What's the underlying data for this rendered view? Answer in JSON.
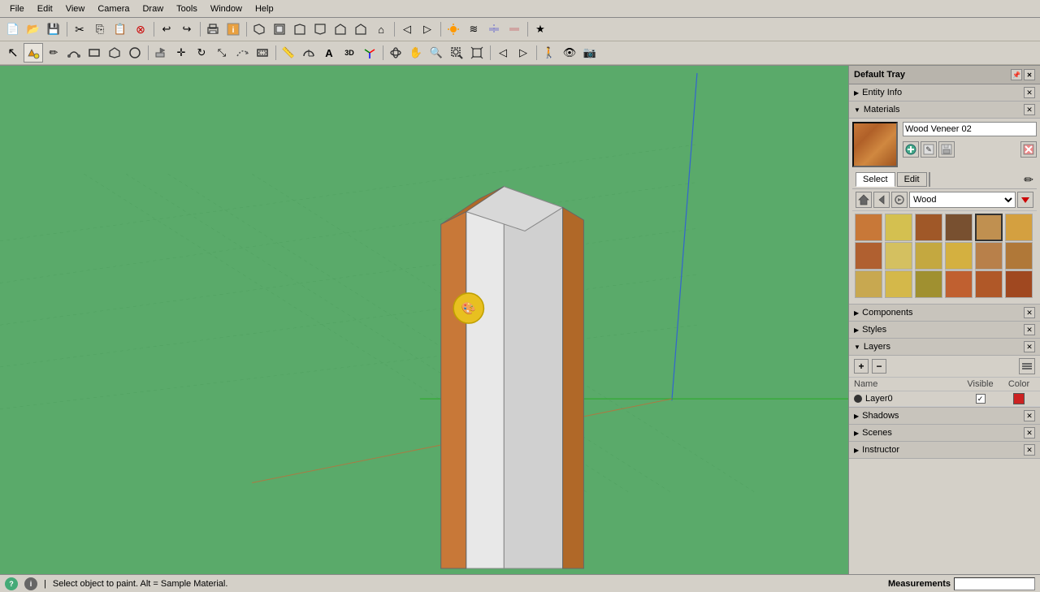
{
  "menubar": {
    "items": [
      "File",
      "Edit",
      "View",
      "Camera",
      "Draw",
      "Tools",
      "Window",
      "Help"
    ]
  },
  "toolbar1": {
    "buttons": [
      {
        "name": "new",
        "icon": "📄"
      },
      {
        "name": "open",
        "icon": "📂"
      },
      {
        "name": "save",
        "icon": "💾"
      },
      {
        "name": "cut",
        "icon": "✂"
      },
      {
        "name": "copy",
        "icon": "📋"
      },
      {
        "name": "paste",
        "icon": "📌"
      },
      {
        "name": "erase",
        "icon": "⊗"
      },
      {
        "name": "undo",
        "icon": "↩"
      },
      {
        "name": "redo",
        "icon": "↪"
      },
      {
        "name": "print",
        "icon": "🖨"
      },
      {
        "name": "model-info",
        "icon": "🔷"
      },
      {
        "name": "3d-warehouse",
        "icon": "🔺"
      },
      {
        "name": "iso",
        "icon": "▣"
      },
      {
        "name": "top",
        "icon": "▢"
      },
      {
        "name": "front",
        "icon": "◧"
      },
      {
        "name": "back",
        "icon": "◨"
      },
      {
        "name": "left",
        "icon": "◩"
      },
      {
        "name": "right",
        "icon": "◪"
      },
      {
        "name": "home",
        "icon": "⌂"
      },
      {
        "name": "standard-views",
        "icon": "⊞"
      },
      {
        "name": "previous",
        "icon": "◁"
      },
      {
        "name": "next",
        "icon": "▷"
      },
      {
        "name": "shadows",
        "icon": "◈"
      },
      {
        "name": "fog",
        "icon": "≋"
      },
      {
        "name": "section",
        "icon": "⊡"
      },
      {
        "name": "section2",
        "icon": "⊠"
      },
      {
        "name": "style",
        "icon": "★"
      }
    ]
  },
  "toolbar2": {
    "buttons": [
      {
        "name": "select",
        "icon": "↖"
      },
      {
        "name": "paint",
        "icon": "🎨"
      },
      {
        "name": "pencil",
        "icon": "✏"
      },
      {
        "name": "rectangle",
        "icon": "▭"
      },
      {
        "name": "circle",
        "icon": "○"
      },
      {
        "name": "line",
        "icon": "╱"
      },
      {
        "name": "pushpull",
        "icon": "⬛"
      },
      {
        "name": "move",
        "icon": "✛"
      },
      {
        "name": "rotate",
        "icon": "↻"
      },
      {
        "name": "scale",
        "icon": "⤡"
      },
      {
        "name": "offset",
        "icon": "⊟"
      },
      {
        "name": "tape",
        "icon": "📏"
      },
      {
        "name": "protractor",
        "icon": "🔭"
      },
      {
        "name": "text",
        "icon": "T"
      },
      {
        "name": "axes",
        "icon": "⊕"
      },
      {
        "name": "dimension",
        "icon": "↔"
      },
      {
        "name": "section-plane",
        "icon": "🔪"
      },
      {
        "name": "orbit",
        "icon": "◎"
      },
      {
        "name": "pan",
        "icon": "✋"
      },
      {
        "name": "zoom",
        "icon": "🔍"
      },
      {
        "name": "zoom-window",
        "icon": "⊞"
      },
      {
        "name": "zoom-extents",
        "icon": "⊞"
      },
      {
        "name": "texture",
        "icon": "⊡"
      },
      {
        "name": "walkthrought",
        "icon": "👁"
      },
      {
        "name": "position-camera",
        "icon": "📷"
      },
      {
        "name": "look-around",
        "icon": "👀"
      },
      {
        "name": "walk",
        "icon": "🚶"
      }
    ]
  },
  "right_panel": {
    "default_tray": "Default Tray",
    "entity_info": "Entity Info",
    "materials": {
      "title": "Materials",
      "current_material": "Wood Veneer 02",
      "tabs": [
        "Select",
        "Edit"
      ],
      "active_tab": "Select",
      "category": "Wood",
      "swatches": [
        "#c87838",
        "#d4b84a",
        "#a05020",
        "#806040",
        "#c89050",
        "#c87838",
        "#b06030",
        "#d4c060",
        "#c0a040",
        "#d4b040",
        "#a06828",
        "#b07030",
        "#c0a050",
        "#d4b84a",
        "#a08828",
        "#c06030",
        "#b05828"
      ],
      "swatch_colors": [
        "#c87838",
        "#d4c050",
        "#a05828",
        "#785030",
        "#c09050",
        "#d4a040",
        "#b06030",
        "#d4c060",
        "#c4a840",
        "#d4b040",
        "#b8804a",
        "#b07838",
        "#c8a850",
        "#d4b84a",
        "#a09030",
        "#c06030",
        "#b05828",
        "#a04820"
      ]
    },
    "components": "Components",
    "styles": "Styles",
    "layers": {
      "title": "Layers",
      "columns": {
        "name": "Name",
        "visible": "Visible",
        "color": "Color"
      },
      "items": [
        {
          "name": "Layer0",
          "visible": true,
          "color": "#cc2222",
          "active": true
        }
      ]
    },
    "shadows": "Shadows",
    "scenes": "Scenes",
    "instructor": "Instructor"
  },
  "statusbar": {
    "status_text": "Select object to paint. Alt = Sample Material.",
    "measurements_label": "Measurements",
    "measurements_value": ""
  }
}
